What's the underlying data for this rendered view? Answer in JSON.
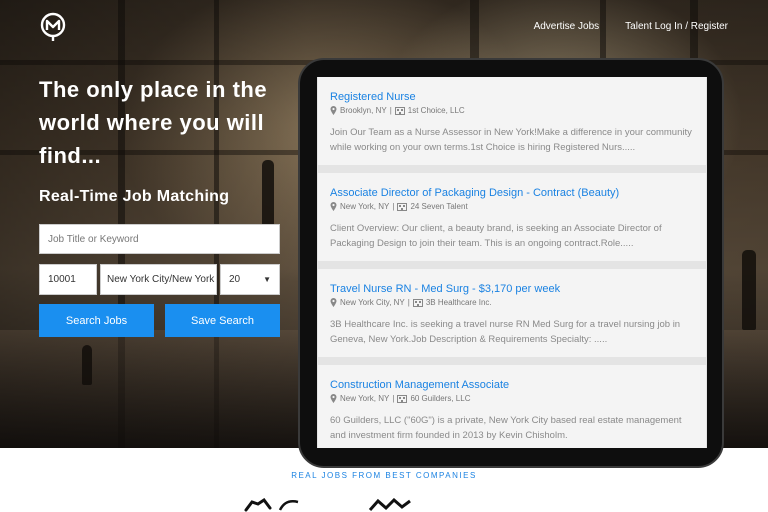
{
  "header": {
    "logo_icon": "m-pin-logo-icon",
    "nav": [
      {
        "label": "Advertise Jobs"
      },
      {
        "label": "Talent Log In / Register"
      }
    ]
  },
  "hero": {
    "headline": "The only place in the world where you will find...",
    "subheading": "Real-Time Job Matching"
  },
  "search_form": {
    "keyword_placeholder": "Job Title or Keyword",
    "zip_value": "10001",
    "city_value": "New York City/New York",
    "radius_value": "20",
    "search_button": "Search Jobs",
    "save_button": "Save Search"
  },
  "jobs": [
    {
      "title": "Registered Nurse",
      "location": "Brooklyn, NY",
      "company": "1st Choice, LLC",
      "description": "Join Our Team as a Nurse Assessor in New York!Make a difference in your community while working on your own terms.1st Choice is hiring Registered Nurs....."
    },
    {
      "title": "Associate Director of Packaging Design - Contract (Beauty)",
      "location": "New York, NY",
      "company": "24 Seven Talent",
      "description": "Client Overview: Our client, a beauty brand, is seeking an Associate Director of Packaging Design to join their team. This is an ongoing contract.Role....."
    },
    {
      "title": "Travel Nurse RN - Med Surg - $3,170 per week",
      "location": "New York City, NY",
      "company": "3B Healthcare Inc.",
      "description": "3B Healthcare Inc. is seeking a travel nurse RN Med Surg for a travel nursing job in Geneva, New York.Job Description & Requirements Specialty: ....."
    },
    {
      "title": "Construction Management Associate",
      "location": "New York, NY",
      "company": "60 Guilders, LLC",
      "description": "60 Guilders, LLC (\"60G\") is a private, New York City based real estate management and investment firm founded in 2013 by Kevin Chisholm."
    }
  ],
  "partners": {
    "title": "REAL JOBS FROM BEST COMPANIES"
  },
  "colors": {
    "accent": "#1a8ff0",
    "link": "#1a82e2"
  }
}
